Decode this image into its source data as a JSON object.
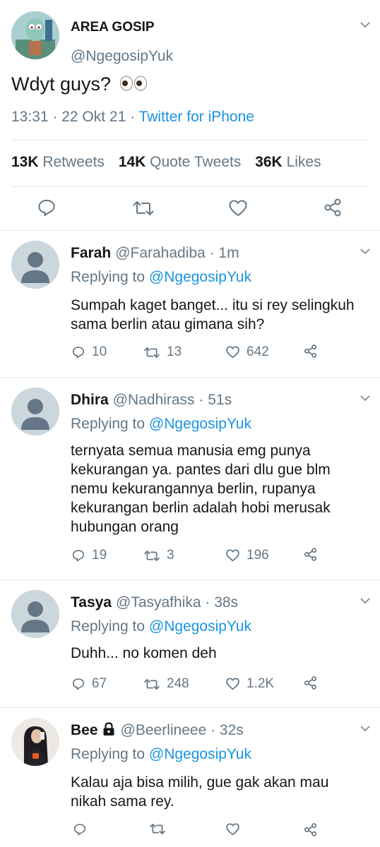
{
  "main_tweet": {
    "name": "AREA GOSIP",
    "handle": "@NgegosipYuk",
    "text": "Wdyt guys?",
    "time": "13:31 · 22 Okt 21 · ",
    "source": "Twitter for iPhone",
    "stats": {
      "retweets_count": "13K",
      "retweets_label": "Retweets",
      "quotes_count": "14K",
      "quotes_label": "Quote Tweets",
      "likes_count": "36K",
      "likes_label": "Likes"
    }
  },
  "replies": [
    {
      "name": "Farah",
      "meta": "@Farahadiba · 1m",
      "replying_label": "Replying to ",
      "replying_to": "@NgegosipYuk",
      "text": "Sumpah kaget banget... itu si rey selingkuh sama berlin atau gimana sih?",
      "replies": "10",
      "retweets": "13",
      "likes": "642"
    },
    {
      "name": "Dhira",
      "meta": "@Nadhirass · 51s",
      "replying_label": "Replying to ",
      "replying_to": "@NgegosipYuk",
      "text": "ternyata semua manusia emg punya kekurangan ya. pantes dari dlu gue blm nemu kekurangannya berlin, rupanya kekurangan berlin adalah hobi merusak hubungan orang",
      "replies": "19",
      "retweets": "3",
      "likes": "196"
    },
    {
      "name": "Tasya",
      "meta": "@Tasyafhika · 38s",
      "replying_label": "Replying to ",
      "replying_to": "@NgegosipYuk",
      "text": "Duhh... no komen deh",
      "replies": "67",
      "retweets": "248",
      "likes": "1.2K"
    },
    {
      "name": "Bee",
      "meta": "@Beerlineee · 32s",
      "replying_label": "Replying to ",
      "replying_to": "@NgegosipYuk",
      "text": "Kalau aja bisa milih, gue gak akan mau nikah sama rey.",
      "replies": "",
      "retweets": "",
      "likes": ""
    }
  ],
  "icons": {
    "reply": "reply-icon",
    "retweet": "retweet-icon",
    "like": "heart-icon",
    "share": "share-icon",
    "more": "chevron-down-icon",
    "lock": "lock-icon"
  },
  "colors": {
    "link": "#1b95e0",
    "muted": "#657786",
    "text": "#14171a",
    "divider": "#e1e8ed"
  }
}
